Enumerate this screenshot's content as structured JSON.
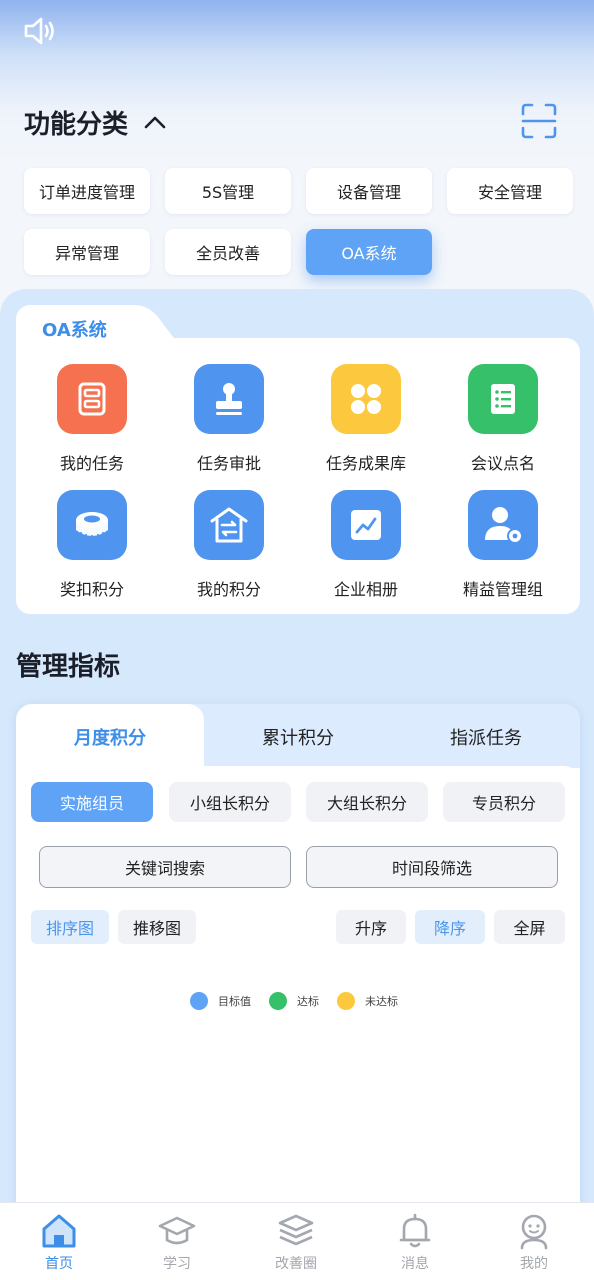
{
  "header": {
    "section_title": "功能分类",
    "speaker_icon": "speaker-icon",
    "collapse_icon": "chevron-up-icon",
    "scan_icon": "scan-icon"
  },
  "categories": [
    {
      "label": "订单进度管理",
      "active": false
    },
    {
      "label": "5S管理",
      "active": false
    },
    {
      "label": "设备管理",
      "active": false
    },
    {
      "label": "安全管理",
      "active": false
    },
    {
      "label": "异常管理",
      "active": false
    },
    {
      "label": "全员改善",
      "active": false
    },
    {
      "label": "OA系统",
      "active": true
    }
  ],
  "oa": {
    "title": "OA系统",
    "apps": [
      {
        "label": "我的任务",
        "icon": "task-list-icon",
        "color": "#f5714f"
      },
      {
        "label": "任务审批",
        "icon": "stamp-icon",
        "color": "#4f95f0"
      },
      {
        "label": "任务成果库",
        "icon": "grid-dots-icon",
        "color": "#fcc93e"
      },
      {
        "label": "会议点名",
        "icon": "checklist-icon",
        "color": "#36c06a"
      },
      {
        "label": "奖扣积分",
        "icon": "tape-measure-icon",
        "color": "#4f95f0"
      },
      {
        "label": "我的积分",
        "icon": "house-transfer-icon",
        "color": "#4f95f0"
      },
      {
        "label": "企业相册",
        "icon": "photo-chart-icon",
        "color": "#4f95f0"
      },
      {
        "label": "精益管理组",
        "icon": "user-gear-icon",
        "color": "#4f95f0"
      }
    ]
  },
  "metrics": {
    "title": "管理指标",
    "tabs": [
      "月度积分",
      "累计积分",
      "指派任务"
    ],
    "active_tab": 0,
    "sub_tabs": [
      "实施组员",
      "小组长积分",
      "大组长积分",
      "专员积分"
    ],
    "active_sub_tab": 0,
    "filters": [
      "关键词搜索",
      "时间段筛选"
    ],
    "chart_types": [
      "排序图",
      "推移图"
    ],
    "active_chart_type": 0,
    "sort_buttons": [
      "升序",
      "降序",
      "全屏"
    ],
    "active_sort": 1,
    "legend": [
      {
        "label": "目标值",
        "color": "#5ea3f5"
      },
      {
        "label": "达标",
        "color": "#36c06a"
      },
      {
        "label": "未达标",
        "color": "#fcc93e"
      }
    ]
  },
  "nav": {
    "items": [
      {
        "label": "首页",
        "icon": "home-icon",
        "active": true
      },
      {
        "label": "学习",
        "icon": "graduation-cap-icon",
        "active": false
      },
      {
        "label": "改善圈",
        "icon": "layers-icon",
        "active": false
      },
      {
        "label": "消息",
        "icon": "bell-icon",
        "active": false
      },
      {
        "label": "我的",
        "icon": "profile-icon",
        "active": false
      }
    ]
  }
}
